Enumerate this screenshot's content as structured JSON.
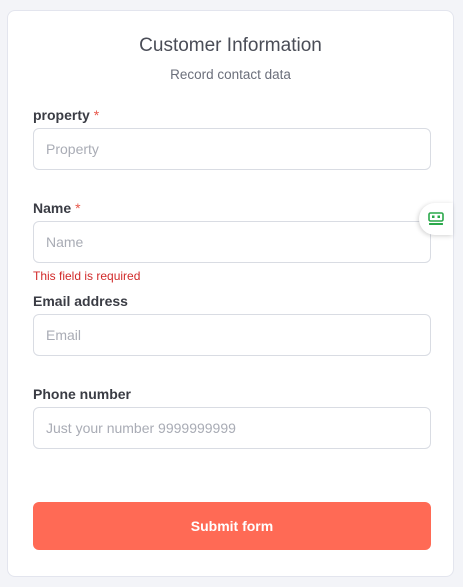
{
  "form": {
    "title": "Customer Information",
    "subtitle": "Record contact data",
    "required_mark": "*",
    "fields": [
      {
        "label": "property",
        "placeholder": "Property",
        "required": true
      },
      {
        "label": "Name",
        "placeholder": "Name",
        "required": true,
        "error": "This field is required"
      },
      {
        "label": "Email address",
        "placeholder": "Email",
        "required": false
      },
      {
        "label": "Phone number",
        "placeholder": "Just your number 9999999999",
        "required": false
      }
    ],
    "submit_label": "Submit form"
  },
  "colors": {
    "accent": "#ff6a55",
    "error": "#d12a2a",
    "required": "#e8574a",
    "widget_icon": "#2aa84a"
  },
  "widget": {
    "icon": "robot-icon"
  }
}
